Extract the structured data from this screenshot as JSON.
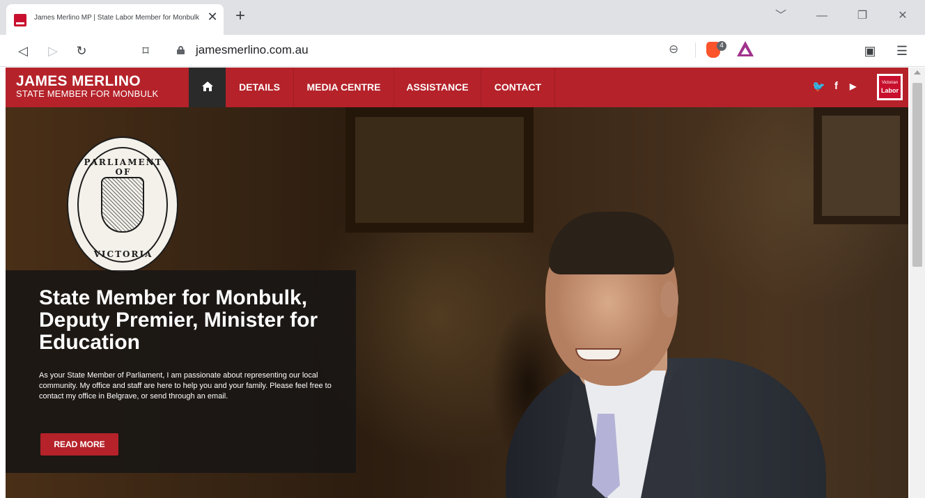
{
  "browser": {
    "tab_title": "James Merlino MP | State Labor Member for Monbulk",
    "tab_close": "✕",
    "new_tab": "+",
    "window_controls": {
      "menu": "﹀",
      "minimize": "—",
      "restore": "❐",
      "close": "✕"
    },
    "nav": {
      "back": "◁",
      "forward": "▷",
      "reload": "↻",
      "bookmark": "⌑"
    },
    "url": "jamesmerlino.com.au",
    "zoom_glyph": "⊖",
    "shields_count": "4",
    "wallet_glyph": "▣",
    "menu_glyph": "☰"
  },
  "site": {
    "brand_name": "JAMES MERLINO",
    "brand_subtitle": "STATE MEMBER FOR MONBULK",
    "nav": [
      "DETAILS",
      "MEDIA CENTRE",
      "ASSISTANCE",
      "CONTACT"
    ],
    "social": {
      "twitter": "🐦",
      "facebook": "f",
      "youtube": "▶"
    },
    "logo_text": [
      "Victorian",
      "Labor"
    ]
  },
  "seal": {
    "top_text": "PARLIAMENT OF",
    "bottom_text": "VICTORIA"
  },
  "hero": {
    "title": "State Member for Monbulk, Deputy Premier, Minister for Education",
    "body": "As your State Member of Parliament, I am passionate about representing our local community. My office and staff are here to help you and your family. Please feel free to contact my office in Belgrave, or send through an email.",
    "button": "READ MORE"
  },
  "colors": {
    "brand_red": "#b5222a",
    "nav_active": "#2a2a2a",
    "card_bg": "#181614"
  },
  "icons": [
    "home-icon",
    "lock-icon",
    "twitter-icon",
    "facebook-icon",
    "youtube-icon",
    "brave-shields-icon",
    "brave-rewards-icon"
  ]
}
